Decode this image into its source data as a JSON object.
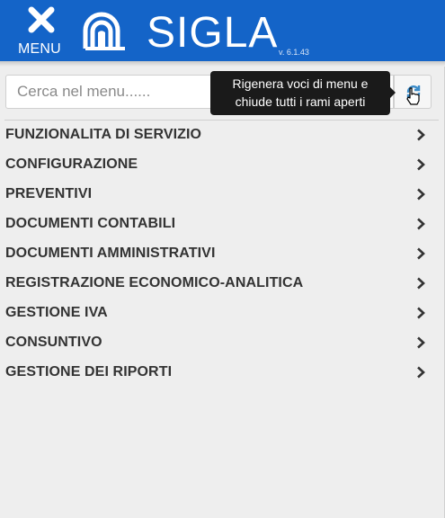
{
  "header": {
    "menu_label": "MENU",
    "brand": "SIGLA",
    "version": "v. 6.1.43",
    "color": "#1464c8"
  },
  "search": {
    "placeholder": "Cerca nel menu......",
    "value": "",
    "refresh_icon": "refresh-icon"
  },
  "tooltip": {
    "line1": "Rigenera voci di menu e",
    "line2": "chiude tutti i rami aperti"
  },
  "menu": {
    "items": [
      {
        "label": "FUNZIONALITA DI SERVIZIO"
      },
      {
        "label": "CONFIGURAZIONE"
      },
      {
        "label": "PREVENTIVI"
      },
      {
        "label": "DOCUMENTI CONTABILI"
      },
      {
        "label": "DOCUMENTI AMMINISTRATIVI"
      },
      {
        "label": "REGISTRAZIONE ECONOMICO-ANALITICA"
      },
      {
        "label": "GESTIONE IVA"
      },
      {
        "label": "CONSUNTIVO"
      },
      {
        "label": "GESTIONE DEI RIPORTI"
      }
    ],
    "chevron_icon": "chevron-right-icon"
  }
}
